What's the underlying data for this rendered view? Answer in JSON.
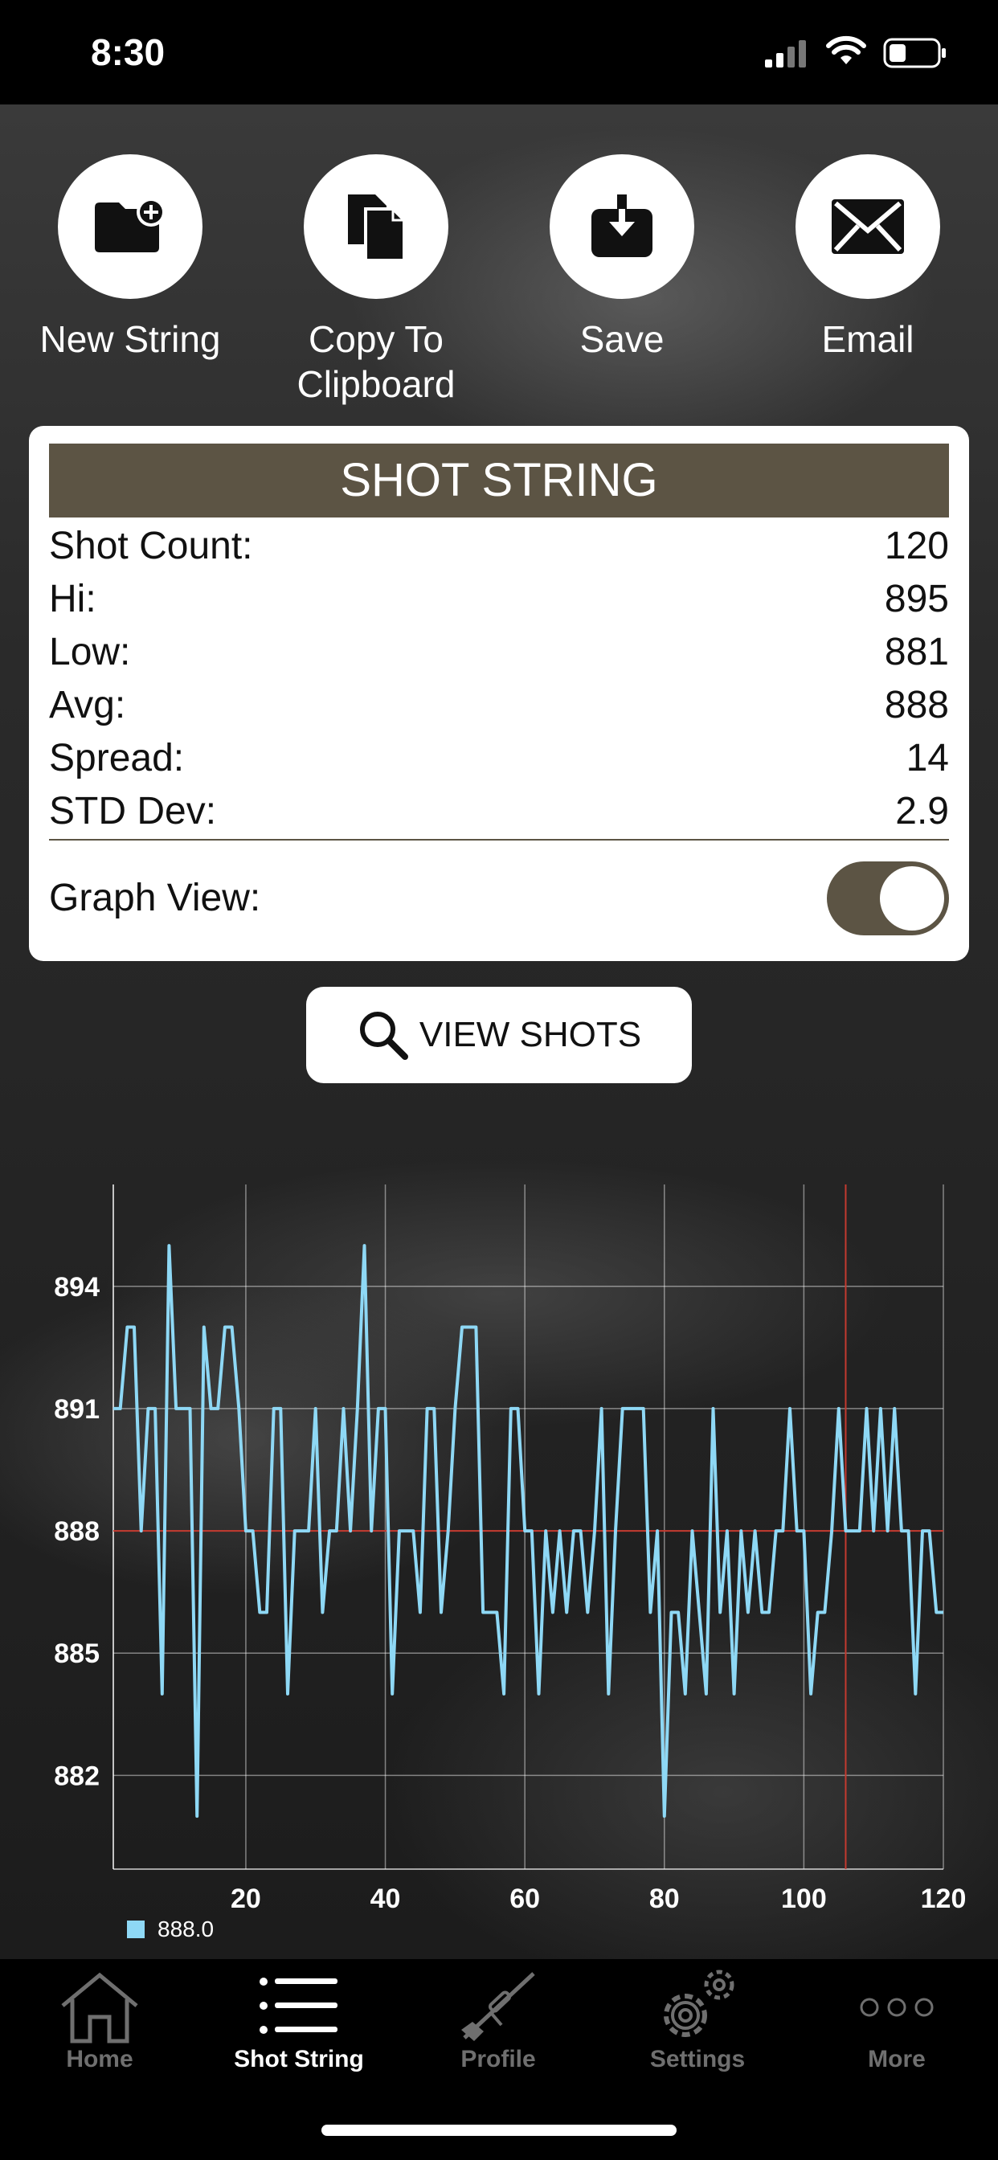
{
  "status_bar": {
    "time": "8:30"
  },
  "actions": [
    {
      "label": "New String",
      "icon": "folder-plus-icon"
    },
    {
      "label": "Copy To Clipboard",
      "icon": "copy-icon"
    },
    {
      "label": "Save",
      "icon": "download-icon"
    },
    {
      "label": "Email",
      "icon": "envelope-icon"
    }
  ],
  "card": {
    "title": "SHOT STRING",
    "stats": [
      {
        "label": "Shot Count:",
        "value": "120"
      },
      {
        "label": "Hi:",
        "value": "895"
      },
      {
        "label": "Low:",
        "value": "881"
      },
      {
        "label": "Avg:",
        "value": "888"
      },
      {
        "label": "Spread:",
        "value": "14"
      },
      {
        "label": "STD Dev:",
        "value": "2.9"
      }
    ],
    "graph_view_label": "Graph View:",
    "graph_view_on": true
  },
  "view_shots_label": "VIEW SHOTS",
  "colors": {
    "accent": "#5c5444",
    "line": "#8ed8f5",
    "reference": "#c43a2f"
  },
  "chart_data": {
    "type": "line",
    "title": "",
    "xlabel": "",
    "ylabel": "",
    "xlim": [
      1,
      120
    ],
    "ylim": [
      879.7,
      896.5
    ],
    "yticks": [
      882,
      885,
      888,
      891,
      894
    ],
    "xticks": [
      20,
      40,
      60,
      80,
      100,
      120
    ],
    "grid": true,
    "legend": "bottom-left",
    "reference_lines": {
      "horizontal": 888,
      "vertical": 106
    },
    "series": [
      {
        "name": "888.0",
        "x": [
          1,
          2,
          3,
          4,
          5,
          6,
          7,
          8,
          9,
          10,
          11,
          12,
          13,
          14,
          15,
          16,
          17,
          18,
          19,
          20,
          21,
          22,
          23,
          24,
          25,
          26,
          27,
          28,
          29,
          30,
          31,
          32,
          33,
          34,
          35,
          36,
          37,
          38,
          39,
          40,
          41,
          42,
          43,
          44,
          45,
          46,
          47,
          48,
          49,
          50,
          51,
          52,
          53,
          54,
          55,
          56,
          57,
          58,
          59,
          60,
          61,
          62,
          63,
          64,
          65,
          66,
          67,
          68,
          69,
          70,
          71,
          72,
          73,
          74,
          75,
          76,
          77,
          78,
          79,
          80,
          81,
          82,
          83,
          84,
          85,
          86,
          87,
          88,
          89,
          90,
          91,
          92,
          93,
          94,
          95,
          96,
          97,
          98,
          99,
          100,
          101,
          102,
          103,
          104,
          105,
          106,
          107,
          108,
          109,
          110,
          111,
          112,
          113,
          114,
          115,
          116,
          117,
          118,
          119,
          120
        ],
        "y": [
          891,
          891,
          893,
          893,
          888,
          891,
          891,
          884,
          895,
          891,
          891,
          891,
          881,
          893,
          891,
          891,
          893,
          893,
          891,
          888,
          888,
          886,
          886,
          891,
          891,
          884,
          888,
          888,
          888,
          891,
          886,
          888,
          888,
          891,
          888,
          891,
          895,
          888,
          891,
          891,
          884,
          888,
          888,
          888,
          886,
          891,
          891,
          886,
          888,
          891,
          893,
          893,
          893,
          886,
          886,
          886,
          884,
          891,
          891,
          888,
          888,
          884,
          888,
          886,
          888,
          886,
          888,
          888,
          886,
          888,
          891,
          884,
          888,
          891,
          891,
          891,
          891,
          886,
          888,
          881,
          886,
          886,
          884,
          888,
          886,
          884,
          891,
          886,
          888,
          884,
          888,
          886,
          888,
          886,
          886,
          888,
          888,
          891,
          888,
          888,
          884,
          886,
          886,
          888,
          891,
          888,
          888,
          888,
          891,
          888,
          891,
          888,
          891,
          888,
          888,
          884,
          888,
          888,
          886,
          886
        ]
      }
    ]
  },
  "tabs": [
    {
      "label": "Home",
      "icon": "home-icon",
      "active": false
    },
    {
      "label": "Shot String",
      "icon": "list-icon",
      "active": true
    },
    {
      "label": "Profile",
      "icon": "rifle-icon",
      "active": false
    },
    {
      "label": "Settings",
      "icon": "gear-icon",
      "active": false
    },
    {
      "label": "More",
      "icon": "more-icon",
      "active": false
    }
  ]
}
